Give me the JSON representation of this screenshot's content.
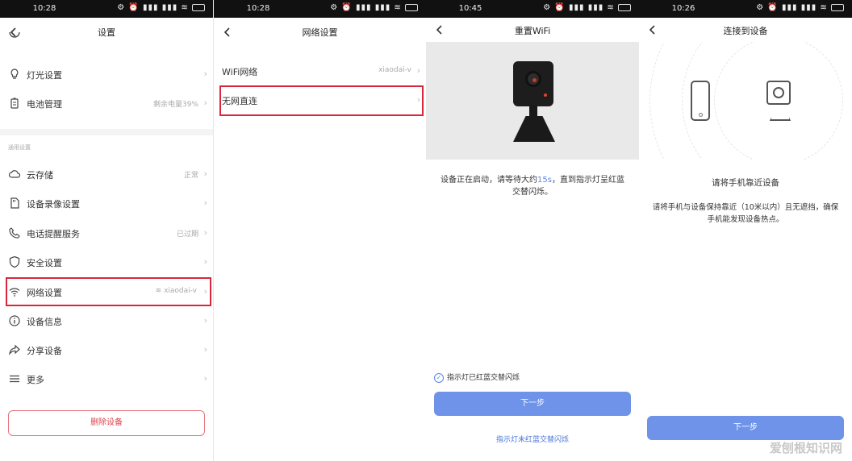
{
  "screens": [
    {
      "status_time": "10:28",
      "title": "设置",
      "rows_top": [
        {
          "label": "灯光设置",
          "value": ""
        },
        {
          "label": "电池管理",
          "value": "剩余电量39%"
        }
      ],
      "section_label": "通用设置",
      "rows": [
        {
          "label": "云存储",
          "value": "正常"
        },
        {
          "label": "设备录像设置",
          "value": ""
        },
        {
          "label": "电话提醒服务",
          "value": "已过期"
        },
        {
          "label": "安全设置",
          "value": ""
        },
        {
          "label": "网络设置",
          "value": "xiaodai-v"
        },
        {
          "label": "设备信息",
          "value": ""
        },
        {
          "label": "分享设备",
          "value": ""
        },
        {
          "label": "更多",
          "value": ""
        }
      ],
      "delete_button": "删除设备"
    },
    {
      "status_time": "10:28",
      "title": "网络设置",
      "rows": [
        {
          "label": "WiFi网络",
          "value": "xiaodai-v"
        },
        {
          "label": "无网直连",
          "value": ""
        }
      ]
    },
    {
      "status_time": "10:45",
      "title": "重置WiFi",
      "desc_pre": "设备正在启动，请等待大约",
      "desc_hl": "15s",
      "desc_post": "，直到指示灯呈红蓝交替闪烁。",
      "check_label": "指示灯已红蓝交替闪烁",
      "next_button": "下一步",
      "link": "指示灯未红蓝交替闪烁"
    },
    {
      "status_time": "10:26",
      "title": "连接到设备",
      "heading": "请将手机靠近设备",
      "desc": "请将手机与设备保持靠近（10米以内）且无遮挡，确保手机能发现设备热点。",
      "next_button": "下一步",
      "watermark": "爱刨根知识网"
    }
  ],
  "colors": {
    "highlight": "#d8273a",
    "primary": "#6e93e8",
    "link": "#4a76d9",
    "danger": "#e0434f"
  }
}
